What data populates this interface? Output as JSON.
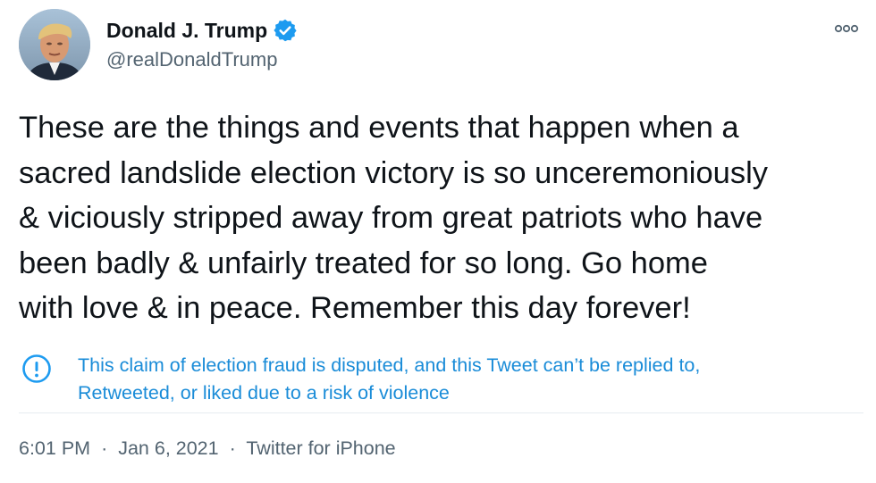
{
  "author": {
    "name": "Donald J. Trump",
    "handle": "@realDonaldTrump",
    "verified": true,
    "avatar_icon": "profile-photo",
    "verified_icon": "verified-badge-icon"
  },
  "menu": {
    "icon": "more-options-icon"
  },
  "tweet": {
    "text": "These are the things and events that happen when a\nsacred landslide election victory is so unceremoniously\n& viciously stripped away from great patriots who have\nbeen badly & unfairly treated for so long. Go home\nwith love & in peace. Remember this day forever!"
  },
  "notice": {
    "icon": "exclamation-circle-icon",
    "line1": "This claim of election fraud is disputed, and this Tweet can’t be replied to,",
    "line2": "Retweeted, or liked due to a risk of violence"
  },
  "meta": {
    "time": "6:01 PM",
    "separator": "·",
    "date": "Jan 6, 2021",
    "source": "Twitter for iPhone"
  },
  "colors": {
    "text": "#0f1419",
    "secondary": "#536471",
    "accent": "#1d9bf0",
    "divider": "#e6ecf0"
  }
}
